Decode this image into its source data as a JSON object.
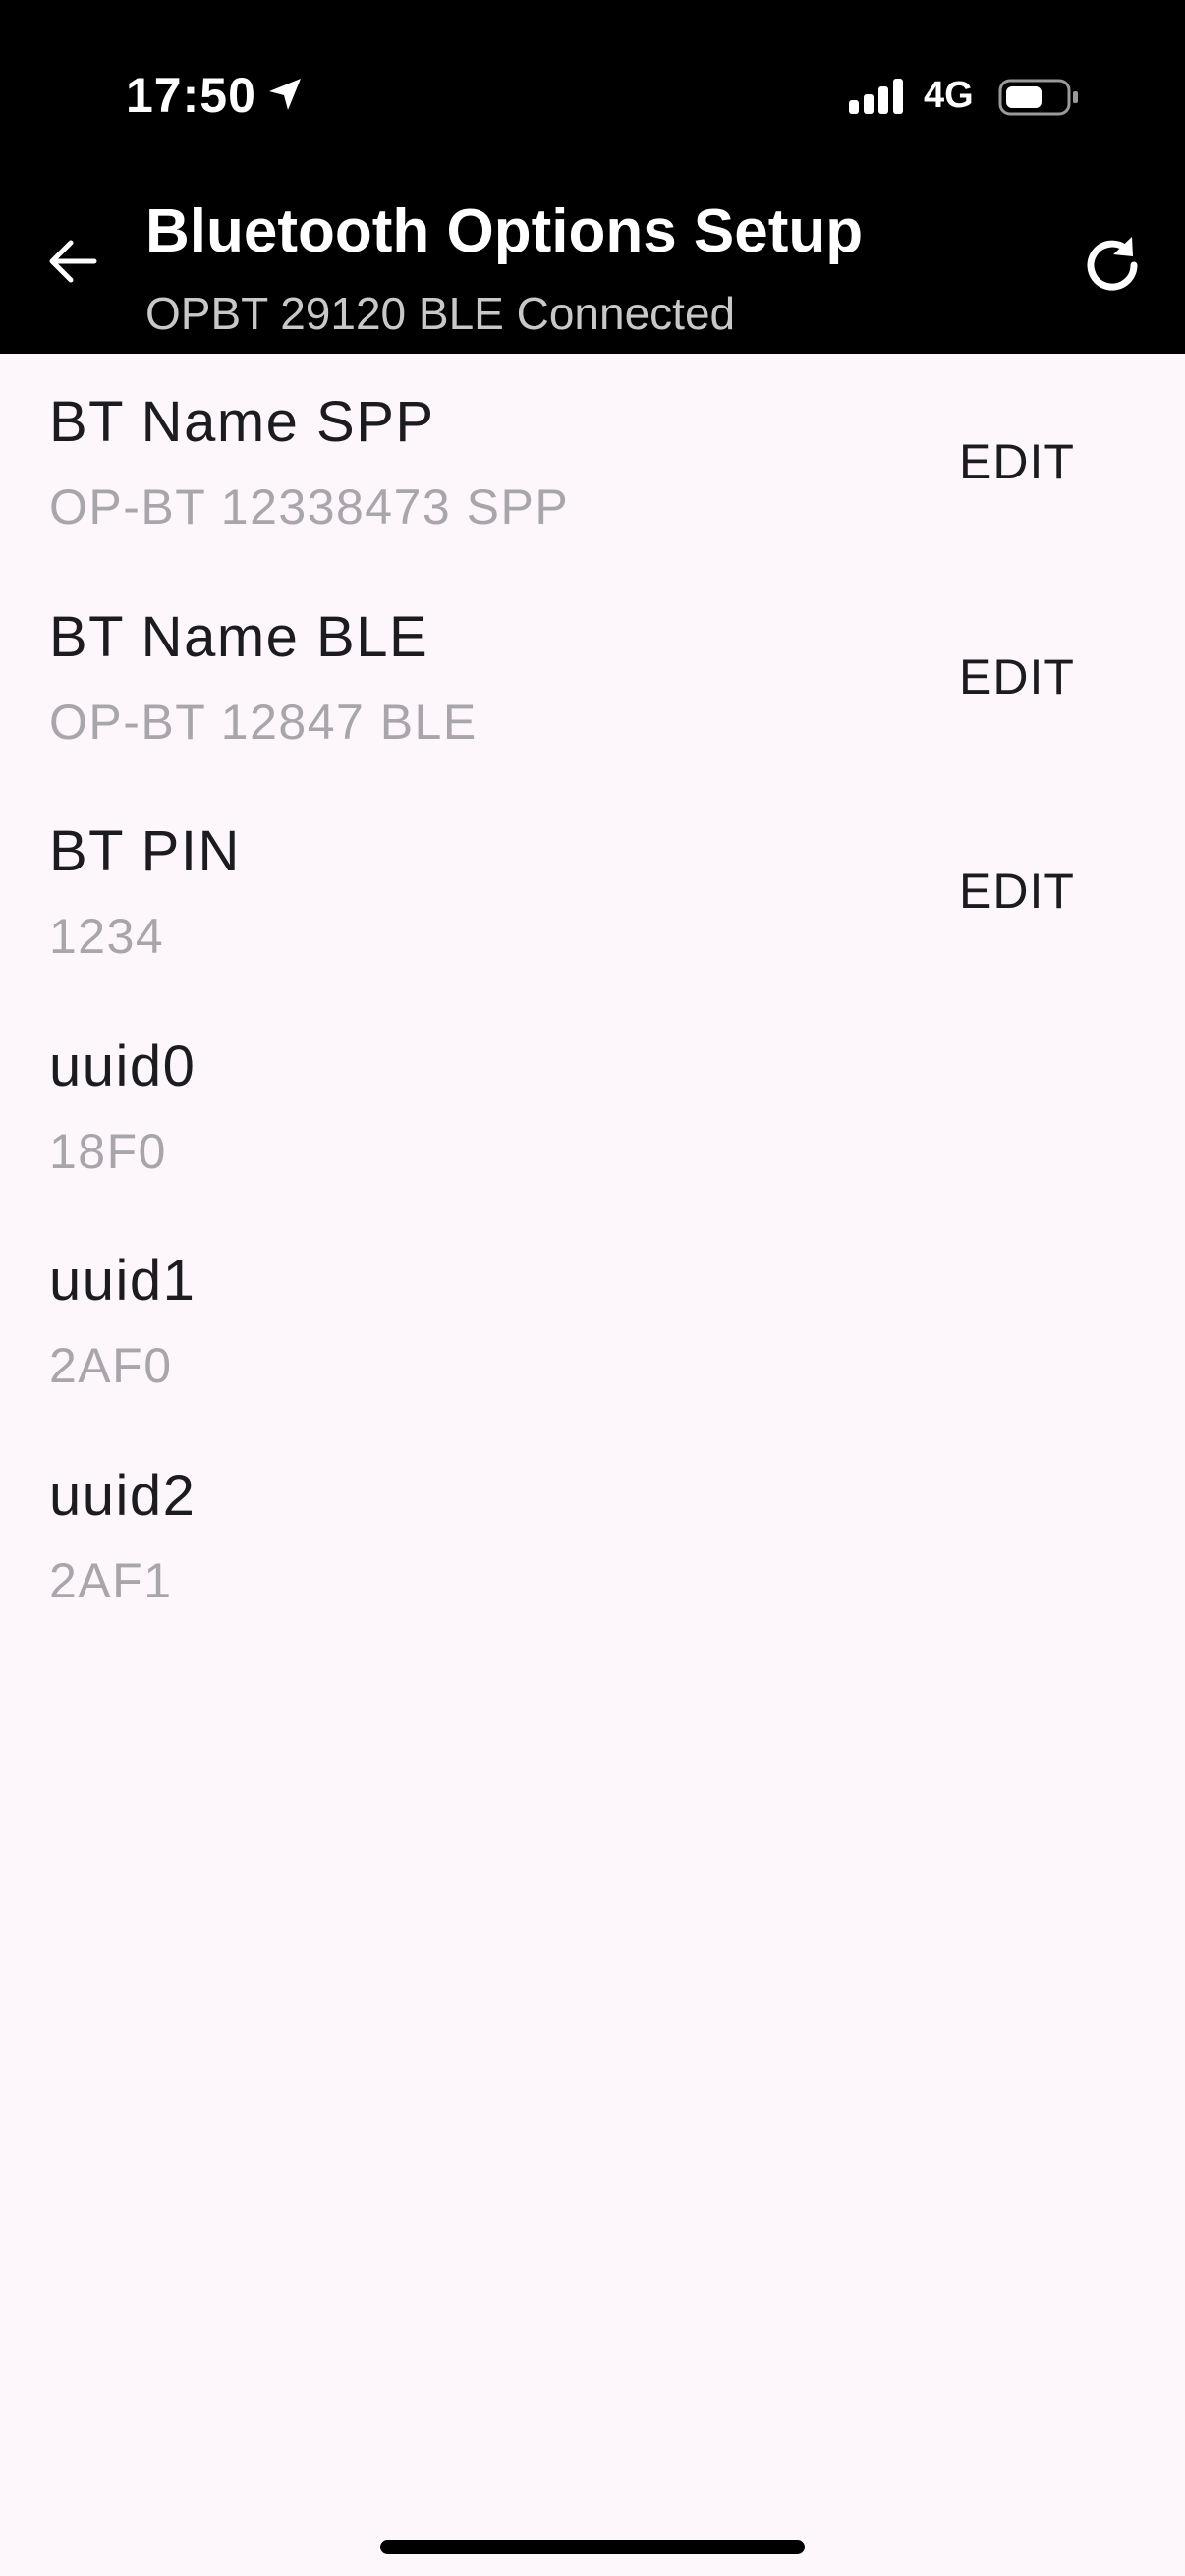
{
  "status_bar": {
    "time": "17:50",
    "network": "4G",
    "icons": [
      "location-arrow-icon",
      "cellular-signal-icon",
      "battery-icon"
    ]
  },
  "header": {
    "title": "Bluetooth Options Setup",
    "subtitle": "OPBT 29120 BLE Connected",
    "back_icon": "back-arrow-icon",
    "refresh_icon": "refresh-icon"
  },
  "settings": [
    {
      "label": "BT Name SPP",
      "value": "OP-BT 12338473 SPP",
      "action": "EDIT"
    },
    {
      "label": "BT Name BLE",
      "value": "OP-BT 12847 BLE",
      "action": "EDIT"
    },
    {
      "label": "BT PIN",
      "value": "1234",
      "action": "EDIT"
    },
    {
      "label": "uuid0",
      "value": "18F0"
    },
    {
      "label": "uuid1",
      "value": "2AF0"
    },
    {
      "label": "uuid2",
      "value": "2AF1"
    }
  ],
  "colors": {
    "header_background": "#000000",
    "page_background": "#fdf7fc",
    "label_text": "#1c1b1f",
    "value_text": "#a9a6ab",
    "subtitle_text": "#c8c8c8"
  }
}
